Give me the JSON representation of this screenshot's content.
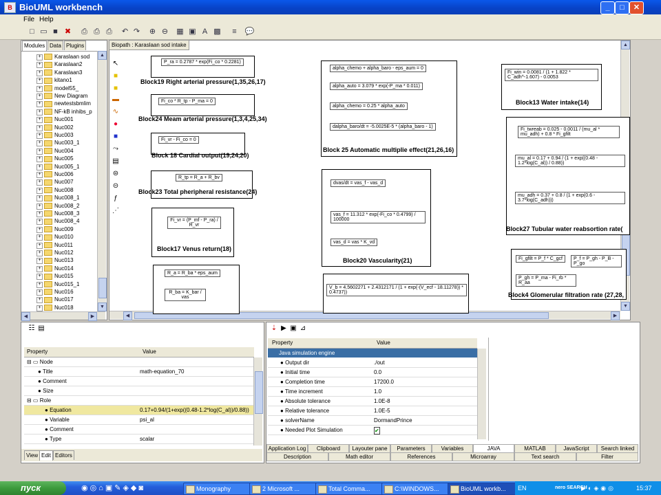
{
  "window": {
    "title": "BioUML workbench"
  },
  "menu": [
    "File",
    "Help"
  ],
  "left_tabs": [
    "Modules",
    "Data",
    "Plugins"
  ],
  "tree": [
    "Karaslaan sod",
    "Karaslaan2",
    "Karaslaan3",
    "kitano1",
    "model55_",
    "New Diagram",
    "newtestsbmlim",
    "NF-kB inhibs_p",
    "Nuc001",
    "Nuc002",
    "Nuc003",
    "Nuc003_1",
    "Nuc004",
    "Nuc005",
    "Nuc005_1",
    "Nuc006",
    "Nuc007",
    "Nuc008",
    "Nuc008_1",
    "Nuc008_2",
    "Nuc008_3",
    "Nuc008_4",
    "Nuc009",
    "Nuc010",
    "Nuc011",
    "Nuc012",
    "Nuc013",
    "Nuc014",
    "Nuc015",
    "Nuc015_1",
    "Nuc016",
    "Nuc017",
    "Nuc018"
  ],
  "diagram_tab": "Biopath : Karaslaan sod intake",
  "blocks": {
    "b19": {
      "eq1": "P_ra = 0.2787 * exp(Fi_co * 0.2281)",
      "label": "Block19 Right arterial pressure(1,35,26,17)"
    },
    "b24": {
      "eq1": "Fi_co * R_tp - P_ma = 0",
      "label": "Block24 Meam arterial pressure(1,3,4,25,34)"
    },
    "b18": {
      "eq1": "Fi_vr - Fi_co = 0",
      "label": "Block 18 Cardial output(19,24,20)"
    },
    "b23": {
      "eq1": "R_tp = R_a + R_bv",
      "label": "Block23 Total pheripheral resistance(24)"
    },
    "b17": {
      "eq1": "Fi_vr = (P_mf - P_ra) / R_vr",
      "label": "Block17 Venus return(18)"
    },
    "b22": {
      "eq1": "R_a = R_ba * eps_aum",
      "eq2": "R_ba = K_bar / vas"
    },
    "b25": {
      "eq1": "alpha_chemo + alpha_baro - eps_aum = 0",
      "eq2": "alpha_auto = 3.079 * exp(-P_ma * 0.011)",
      "eq3": "alpha_chemo = 0.25 * alpha_auto",
      "eq4": "dalpha_baro/dt = -5.0025E-5 * (alpha_baro - 1)",
      "label": "Block 25 Automatic multiplie effect(21,26,16)"
    },
    "b20": {
      "eq1": "dvas/dt = vas_f - vas_d",
      "eq2": "vas_f = 11.312 * exp(-Fi_co * 0.4799) / 100000",
      "eq3": "vas_d = vas * K_vd",
      "label": "Block20 Vascularity(21)"
    },
    "b21": {
      "eq1": "V_b = 4.5602271 + 2.4312171 / (1 + exp(-(V_ecf - 18.11278)) * 0.4737))"
    },
    "b13": {
      "eq1": "Fi_win = 0.0081 / (1 + 1.822 * C_adh^-1.607) - 0.0053",
      "label": "Block13 Water intake(14)"
    },
    "b27": {
      "eq1": "Fi_twreab = 0.025 - 0.0011 / (mu_al * mu_adh) + 0.8 * Fi_gfilt",
      "eq2": "mu_al = 0.17 + 0.94 / (1 + exp((0.48 - 1.2*log(C_al)) / 0.88))",
      "eq3": "mu_adh = 0.37 + 0.8 / (1 + exp(0.6 - 3.7*log(C_adh)))",
      "label": "Block27 Tubular water reabsortion rate("
    },
    "b4": {
      "eq1": "Fi_gfilt = P_f * C_gcf",
      "eq2": "P_f = P_gh - P_B - P_go",
      "eq3": "P_gh = P_ma - Fi_rb * R_aa",
      "label": "Block4 Glomerular filtration rate (27,28,"
    }
  },
  "props": {
    "col_property": "Property",
    "col_value": "Value",
    "rows": [
      {
        "k": "Node",
        "v": ""
      },
      {
        "k": "Title",
        "v": "math-equation_70"
      },
      {
        "k": "Comment",
        "v": ""
      },
      {
        "k": "Size",
        "v": ""
      },
      {
        "k": "Role",
        "v": ""
      },
      {
        "k": "Equation",
        "v": "0.17+0.94/(1+exp((0.48-1.2*log(C_al))/0.88))"
      },
      {
        "k": "Variable",
        "v": "psi_al"
      },
      {
        "k": "Comment",
        "v": ""
      },
      {
        "k": "Type",
        "v": "scalar"
      }
    ],
    "bottom_tabs": [
      "View",
      "Edit",
      "Editors"
    ]
  },
  "sim": {
    "col_property": "Property",
    "col_value": "Value",
    "group": "Java simulation engine",
    "rows": [
      {
        "k": "Output dir",
        "v": "./out"
      },
      {
        "k": "Initial time",
        "v": "0.0"
      },
      {
        "k": "Completion time",
        "v": "17200.0"
      },
      {
        "k": "Time increment",
        "v": "1.0"
      },
      {
        "k": "Absolute tolerance",
        "v": "1.0E-8"
      },
      {
        "k": "Relative tolerance",
        "v": "1.0E-5"
      },
      {
        "k": "solverName",
        "v": "DormandPrince"
      },
      {
        "k": "Needed Plot Simulation",
        "v": "✔"
      }
    ],
    "tabs1": [
      "Application Log",
      "Clipboard",
      "Layouter pane",
      "Parameters",
      "Variables",
      "JAVA",
      "MATLAB",
      "JavaScript",
      "Search linked"
    ],
    "tabs2": [
      "Description",
      "Math editor",
      "References",
      "Microarray",
      "Text search",
      "Filter"
    ]
  },
  "taskbar": {
    "start": "пуск",
    "tasks": [
      "Monography",
      "2 Microsoft ...",
      "Total Comma...",
      "C:\\WINDOWS...",
      "BioUML workb..."
    ],
    "lang": "EN",
    "nero": "nero SEARCH",
    "time": "15:37"
  }
}
